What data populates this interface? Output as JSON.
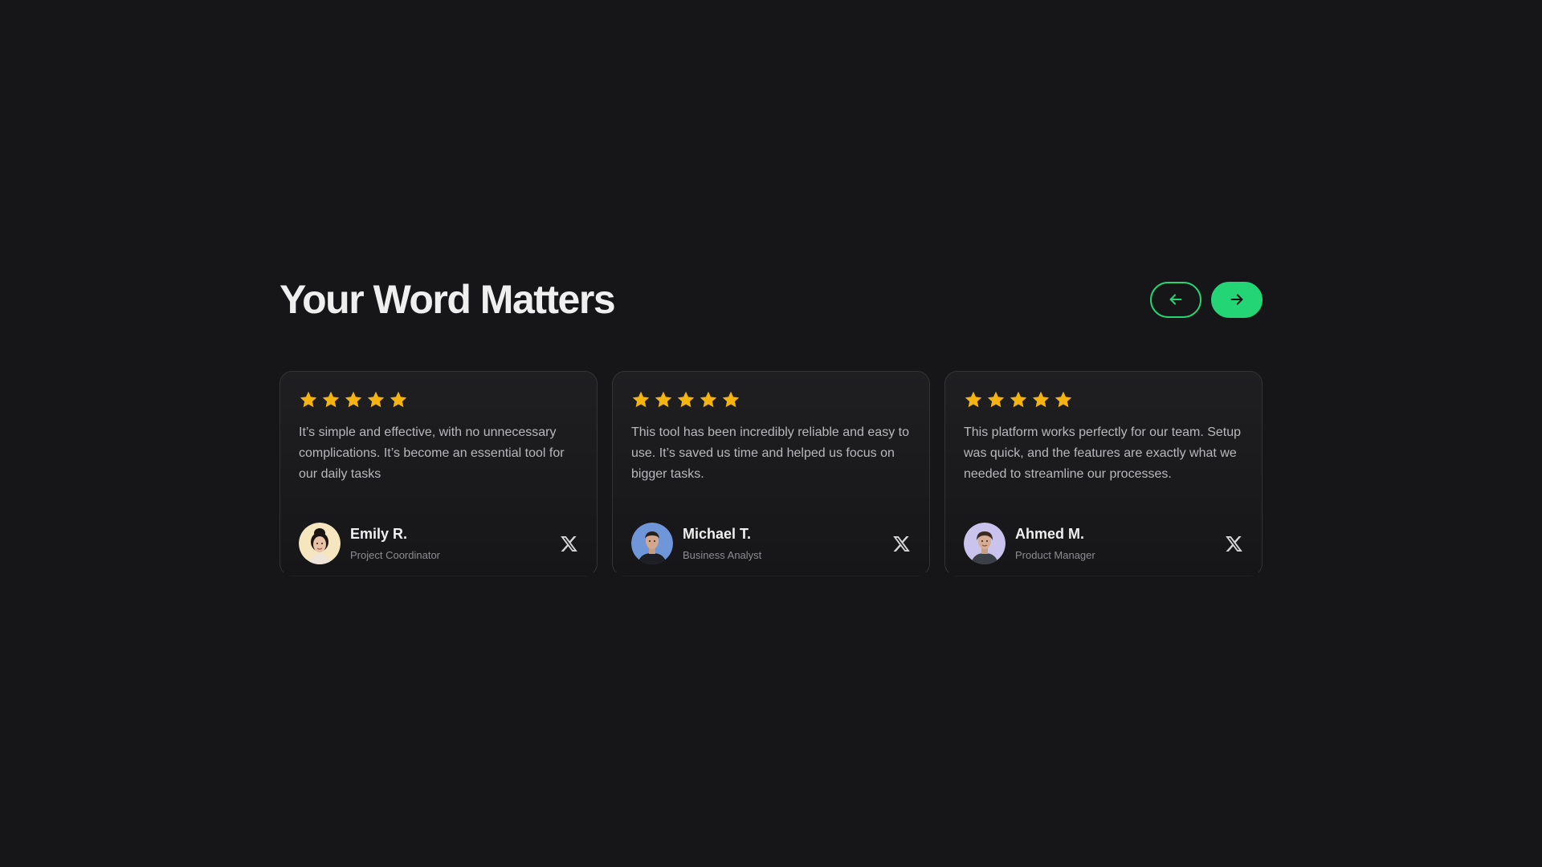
{
  "section": {
    "title": "Your Word Matters",
    "prev_icon": "arrow-left-icon",
    "next_icon": "arrow-right-icon"
  },
  "colors": {
    "background": "#161618",
    "accent": "#24d576",
    "star": "#f5b30f"
  },
  "testimonials": [
    {
      "rating": 5,
      "quote": "It’s simple and effective, with no unnecessary complications. It’s become an essential tool for our daily tasks",
      "name": "Emily R.",
      "role": "Project Coordinator",
      "social_icon": "x-icon"
    },
    {
      "rating": 5,
      "quote": "This tool has been incredibly reliable and easy to use. It’s saved us time and helped us focus on bigger tasks.",
      "name": "Michael T.",
      "role": "Business Analyst",
      "social_icon": "x-icon"
    },
    {
      "rating": 5,
      "quote": "This platform works perfectly for our team. Setup was quick, and the features are exactly what we needed to streamline our processes.",
      "name": "Ahmed M.",
      "role": "Product Manager",
      "social_icon": "x-icon"
    }
  ]
}
